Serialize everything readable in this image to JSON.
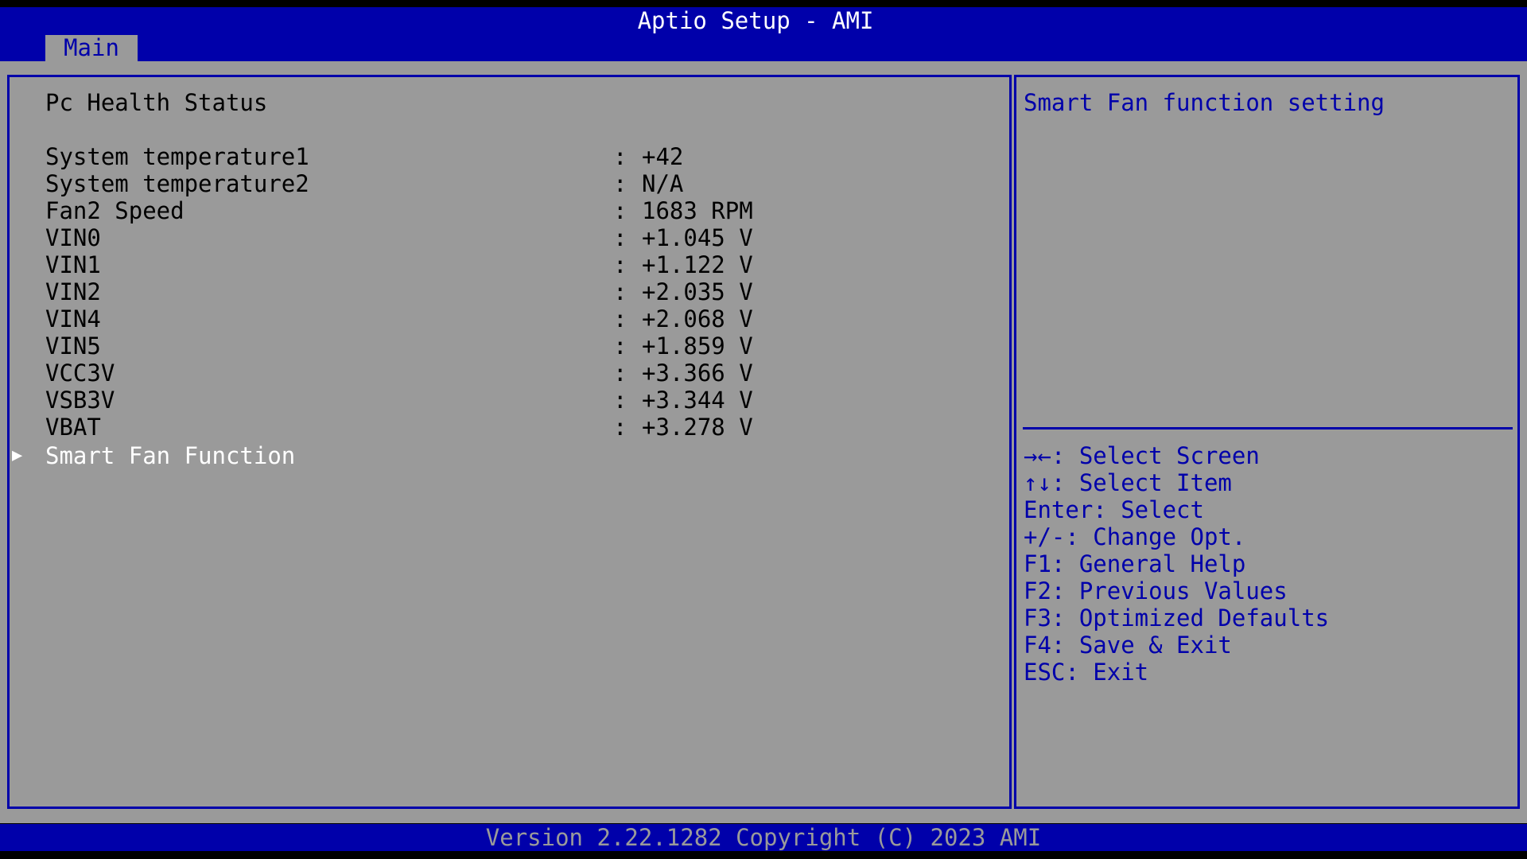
{
  "header": {
    "title": "Aptio Setup - AMI",
    "tabs": [
      {
        "label": "Main",
        "active": true
      }
    ]
  },
  "main": {
    "heading": "Pc Health Status",
    "rows": [
      {
        "label": "System temperature1",
        "value": "+42"
      },
      {
        "label": "System temperature2",
        "value": "N/A"
      },
      {
        "label": "Fan2 Speed",
        "value": "1683 RPM"
      },
      {
        "label": "VIN0",
        "value": "+1.045 V"
      },
      {
        "label": "VIN1",
        "value": "+1.122 V"
      },
      {
        "label": "VIN2",
        "value": "+2.035 V"
      },
      {
        "label": "VIN4",
        "value": "+2.068 V"
      },
      {
        "label": "VIN5",
        "value": "+1.859 V"
      },
      {
        "label": "VCC3V",
        "value": "+3.366 V"
      },
      {
        "label": "VSB3V",
        "value": "+3.344 V"
      },
      {
        "label": "VBAT",
        "value": "+3.278 V"
      }
    ],
    "separator": ":",
    "submenu": {
      "arrow": "▶",
      "label": "Smart Fan Function",
      "selected": true
    }
  },
  "help": {
    "description": "Smart Fan function setting",
    "keys": [
      "→←: Select Screen",
      "↑↓: Select Item",
      "Enter: Select",
      "+/-: Change Opt.",
      "F1: General Help",
      "F2: Previous Values",
      "F3: Optimized Defaults",
      "F4: Save & Exit",
      "ESC: Exit"
    ]
  },
  "footer": {
    "text": "Version 2.22.1282 Copyright (C) 2023 AMI"
  },
  "colors": {
    "bar_blue": "#0000aa",
    "panel_gray": "#9a9a9a",
    "text_black": "#000000",
    "selected_white": "#ffffff"
  }
}
